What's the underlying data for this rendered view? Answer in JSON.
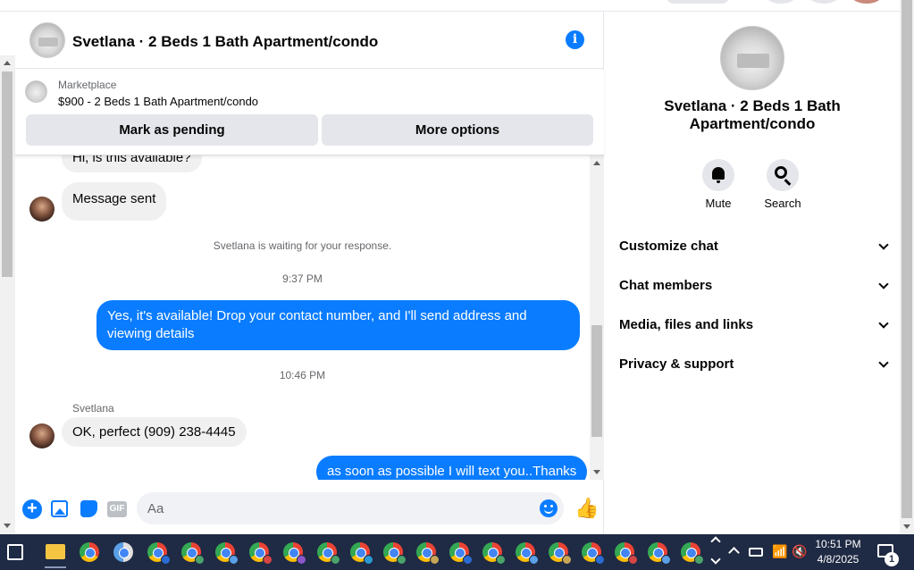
{
  "chat": {
    "title": "Svetlana · 2 Beds 1 Bath Apartment/condo",
    "marketplace_label": "Marketplace",
    "listing": "$900 - 2 Beds 1 Bath Apartment/condo",
    "mark_pending_label": "Mark as pending",
    "more_options_label": "More options"
  },
  "messages": {
    "partial_text": "Hi, is this available?",
    "sent_text": "Message sent",
    "waiting_text": "Svetlana is waiting for your response.",
    "time1": "9:37 PM",
    "out1": "Yes, it's available! Drop your contact number, and I'll send address and viewing details",
    "time2": "10:46 PM",
    "sender": "Svetlana",
    "in2": "OK, perfect (909) 238-4445",
    "out2": "as soon as possible I will text you..Thanks",
    "reaction": "❤"
  },
  "composer": {
    "placeholder": "Aa",
    "gif_label": "GIF",
    "like_icon": "👍"
  },
  "panel": {
    "title": "Svetlana · 2 Beds 1 Bath Apartment/condo",
    "mute_label": "Mute",
    "search_label": "Search",
    "sections": [
      "Customize chat",
      "Chat members",
      "Media, files and links",
      "Privacy & support"
    ]
  },
  "taskbar": {
    "time": "10:51 PM",
    "date": "4/8/2025",
    "notification_count": "1",
    "wifi_icon": "📶",
    "volume_icon": "🔇"
  },
  "colors": {
    "accent": "#0a7cff",
    "bubble_incoming": "#f0f0f0",
    "taskbar": "#1f2a44"
  }
}
